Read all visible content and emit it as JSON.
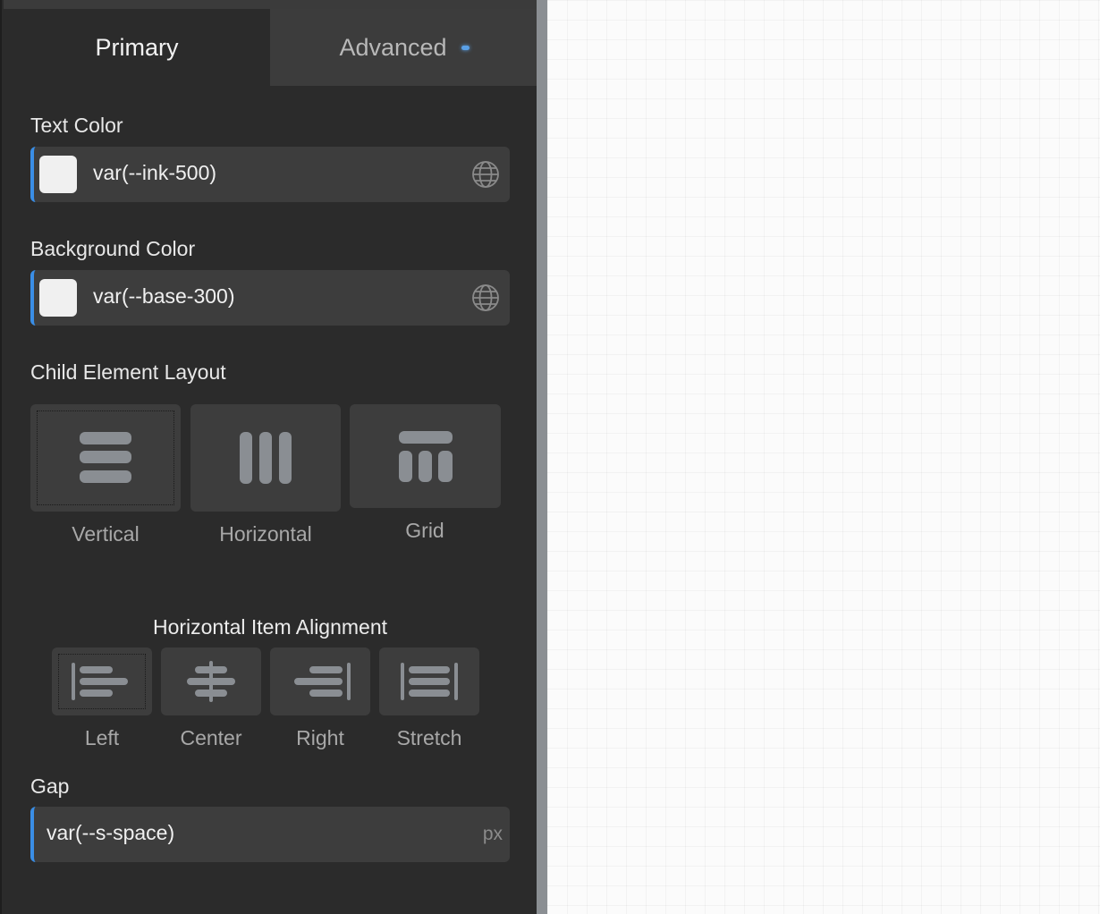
{
  "tabs": {
    "primary_label": "Primary",
    "advanced_label": "Advanced"
  },
  "text_color": {
    "label": "Text Color",
    "value": "var(--ink-500)",
    "swatch_color": "#f0f0f0",
    "icon": "globe-icon"
  },
  "background_color": {
    "label": "Background Color",
    "value": "var(--base-300)",
    "swatch_color": "#f0f0f0",
    "icon": "globe-icon"
  },
  "layout": {
    "label": "Child Element Layout",
    "options": [
      {
        "label": "Vertical",
        "icon": "layout-vertical-icon",
        "selected": true
      },
      {
        "label": "Horizontal",
        "icon": "layout-horizontal-icon",
        "selected": false
      },
      {
        "label": "Grid",
        "icon": "layout-grid-icon",
        "selected": false
      }
    ]
  },
  "alignment": {
    "title": "Horizontal Item Alignment",
    "options": [
      {
        "label": "Left",
        "icon": "align-left-icon",
        "selected": true
      },
      {
        "label": "Center",
        "icon": "align-center-icon",
        "selected": false
      },
      {
        "label": "Right",
        "icon": "align-right-icon",
        "selected": false
      },
      {
        "label": "Stretch",
        "icon": "align-stretch-icon",
        "selected": false
      }
    ]
  },
  "gap": {
    "label": "Gap",
    "value": "var(--s-space)",
    "unit": "px"
  },
  "colors": {
    "accent": "#3a8ee6",
    "panel_bg": "#2b2b2b",
    "control_bg": "#3d3d3d",
    "icon_gray": "#8a8e93"
  }
}
